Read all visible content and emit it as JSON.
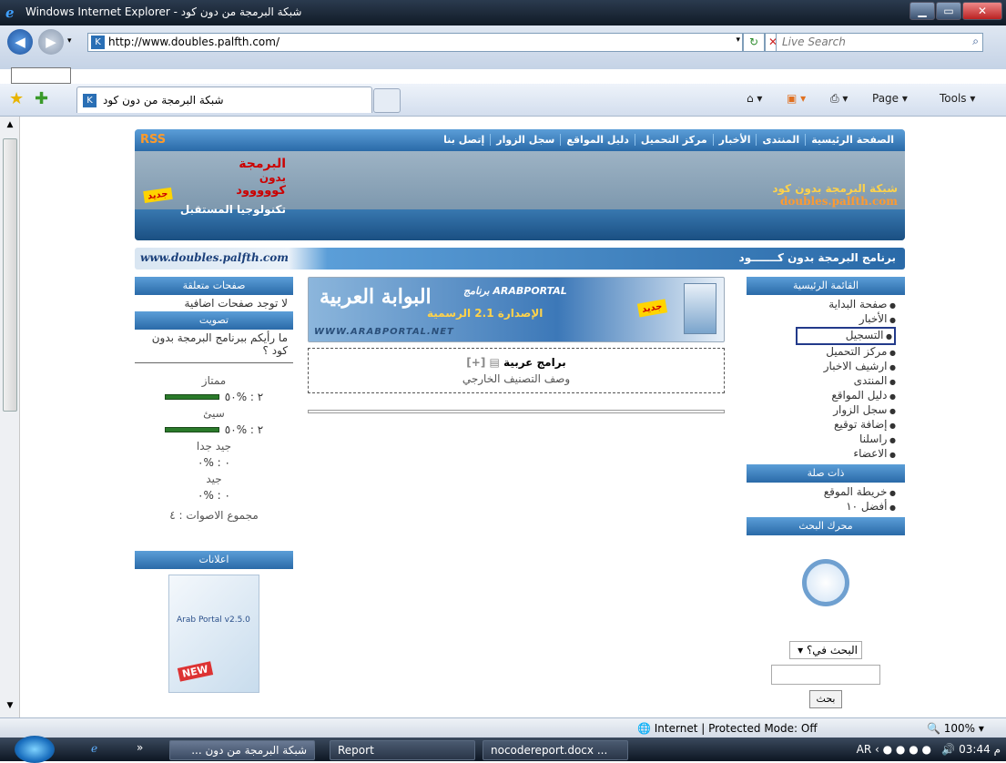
{
  "window": {
    "title": "Windows Internet Explorer - شبكة البرمجة من دون كود"
  },
  "address": {
    "url": "http://www.doubles.palfth.com/",
    "search_placeholder": "Live Search"
  },
  "tab": {
    "label": "شبكة البرمجة من دون كود"
  },
  "commandbar": {
    "page": "Page ▾",
    "tools": "Tools ▾"
  },
  "site": {
    "rss": "RSS",
    "nav": [
      "الصفحة الرئيسية",
      "المنتدى",
      "الأخبار",
      "مركز التحميل",
      "دليل المواقع",
      "سجل الزوار",
      "إتصل بنا"
    ],
    "logo": {
      "line1": "البرمجة",
      "line2": "بدون",
      "line3": "كووووود",
      "badge": "جديد",
      "tagline": "تكنولوجيا المستقبل"
    },
    "name_ar": "شبكة البرمجة بدون كود",
    "name_en": "doubles.palfth.com",
    "url_strip": "www.doubles.palfth.com",
    "program_strip": "برنامج البرمجة بدون كـــــــود"
  },
  "left": {
    "related_header": "صفحات متعلقة",
    "related_text": "لا توجد صفحات اضافية",
    "poll_header": "تصويت",
    "poll_question": "ما رأيكم ببرنامج البرمجة بدون كود ؟",
    "poll": [
      {
        "label": "ممتاز",
        "value": "٢ : %٥٠",
        "pct": 50
      },
      {
        "label": "سيئ",
        "value": "٢ : %٥٠",
        "pct": 50
      },
      {
        "label": "جيد جدا",
        "value": "٠ : %٠",
        "pct": 0
      },
      {
        "label": "جيد",
        "value": "٠ : %٠",
        "pct": 0
      }
    ],
    "total": "مجموع الاصوات : ٤",
    "ads_header": "اعلانات",
    "ad_text": "Arab Portal v2.5.0",
    "ad_new": "NEW"
  },
  "center": {
    "banner_ar": "البوابة العربية",
    "banner_en": "برنامج ARABPORTAL",
    "banner_version": "الإصدارة 2.1 الرسمية",
    "banner_new": "جديد",
    "banner_url": "WWW.ARABPORTAL.NET",
    "category_title": "برامج عربية",
    "category_desc": "وصف التصنيف الخارجي"
  },
  "right": {
    "main_header": "القائمة الرئيسية",
    "main_items": [
      "صفحة البداية",
      "الأخبار",
      "التسجيل",
      "مركز التحميل",
      "ارشيف الاخبار",
      "المنتدى",
      "دليل المواقع",
      "سجل الزوار",
      "إضافة توقيع",
      "راسلنا",
      "الاعضاء"
    ],
    "related_header": "ذات صلة",
    "related_items": [
      "خريطة الموقع",
      "أفضل ١٠"
    ],
    "search_header": "محرك البحث",
    "search_select": "البحث في؟",
    "search_button": "بحث"
  },
  "status": {
    "zone": "Internet | Protected Mode: Off",
    "zoom": "100%"
  },
  "taskbar": {
    "items": [
      "شبكة البرمجة من دون ...",
      "Report",
      "nocodereport.docx ..."
    ],
    "lang": "AR",
    "time": "03:44 م"
  }
}
